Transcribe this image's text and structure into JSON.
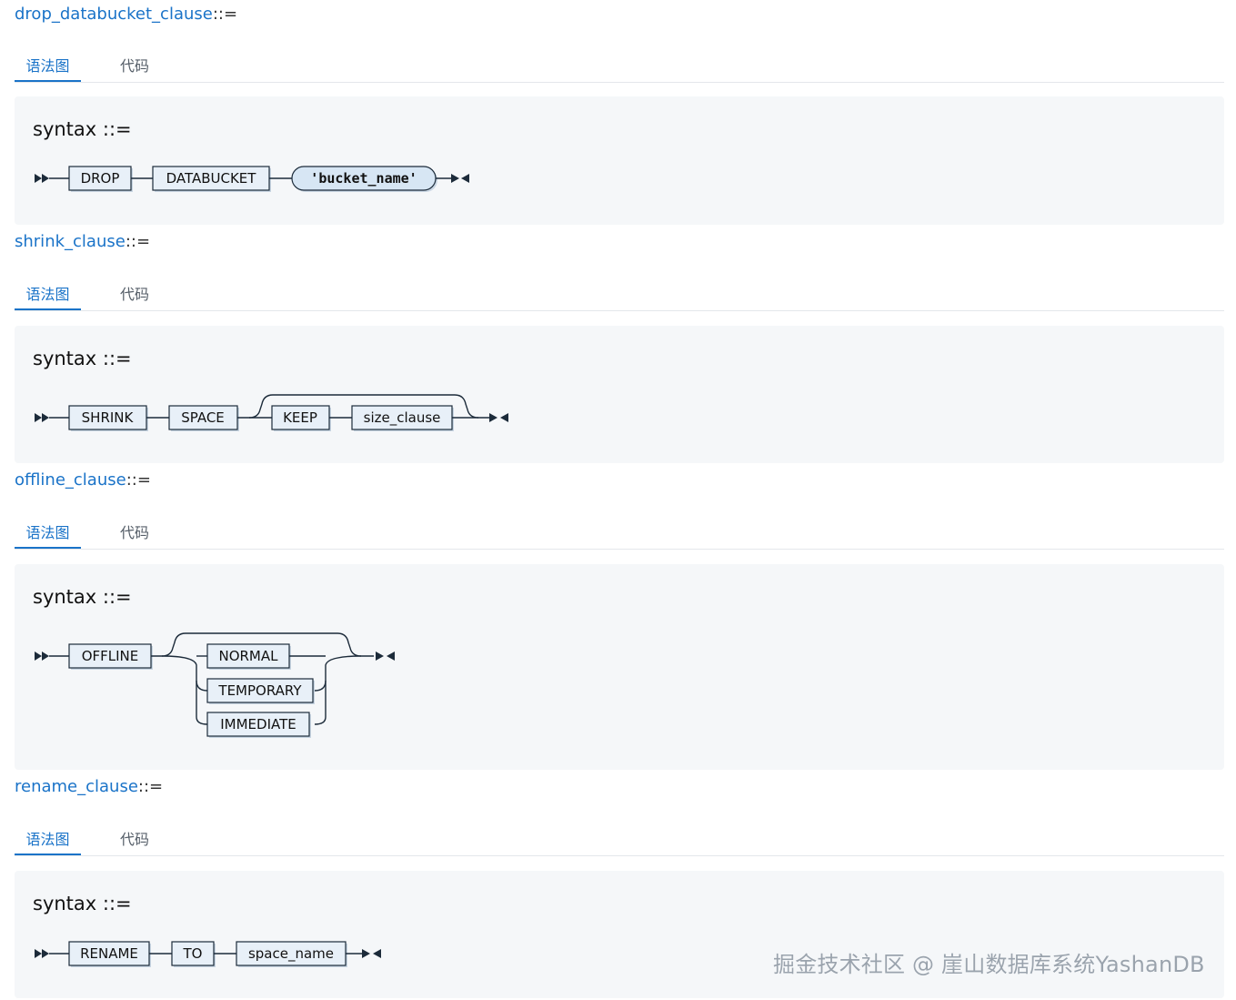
{
  "sections": [
    {
      "name": "drop_databucket_clause",
      "op": "::=",
      "tabs": [
        "语法图",
        "代码"
      ],
      "syntax_label": "syntax ::=",
      "tokens": [
        "DROP",
        "DATABUCKET",
        "'bucket_name'"
      ]
    },
    {
      "name": "shrink_clause",
      "op": "::=",
      "tabs": [
        "语法图",
        "代码"
      ],
      "syntax_label": "syntax ::=",
      "tokens": [
        "SHRINK",
        "SPACE",
        "KEEP",
        "size_clause"
      ]
    },
    {
      "name": "offline_clause",
      "op": "::=",
      "tabs": [
        "语法图",
        "代码"
      ],
      "syntax_label": "syntax ::=",
      "tokens": [
        "OFFLINE",
        "NORMAL",
        "TEMPORARY",
        "IMMEDIATE"
      ]
    },
    {
      "name": "rename_clause",
      "op": "::=",
      "tabs": [
        "语法图",
        "代码"
      ],
      "syntax_label": "syntax ::=",
      "tokens": [
        "RENAME",
        "TO",
        "space_name"
      ]
    }
  ],
  "watermark": "掘金技术社区 @ 崖山数据库系统YashanDB",
  "colors": {
    "link": "#1a73c8",
    "panel_bg": "#f5f7f9",
    "node_fill": "#e8f0f8",
    "literal_fill": "#d7e6f4",
    "line": "#1c2b3a"
  }
}
